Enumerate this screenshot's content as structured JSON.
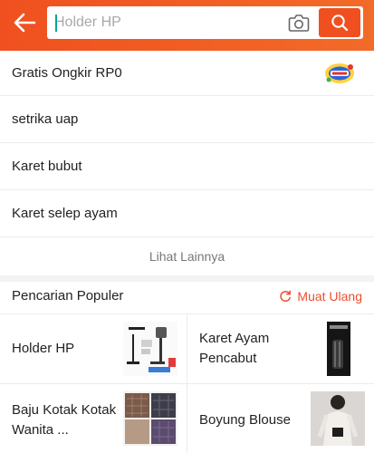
{
  "header": {
    "back_icon": "arrow-left-icon",
    "search": {
      "placeholder": "Holder HP",
      "value": ""
    },
    "camera_icon": "camera-icon",
    "search_icon": "search-icon",
    "colors": {
      "bar": "#f0501f",
      "caret": "#0aa39a"
    }
  },
  "history": {
    "items": [
      {
        "label": "Gratis Ongkir RP0"
      },
      {
        "label": "setrika uap"
      },
      {
        "label": "Karet bubut"
      },
      {
        "label": "Karet selep ayam"
      }
    ],
    "see_more": "Lihat Lainnya"
  },
  "popular": {
    "title": "Pencarian Populer",
    "reload_label": "Muat Ulang",
    "items": [
      {
        "label": "Holder HP"
      },
      {
        "label": "Karet Ayam Pencabut"
      },
      {
        "label": "Baju Kotak Kotak Wanita ..."
      },
      {
        "label": "Boyung Blouse"
      }
    ],
    "accent": "#ee4d2d"
  }
}
